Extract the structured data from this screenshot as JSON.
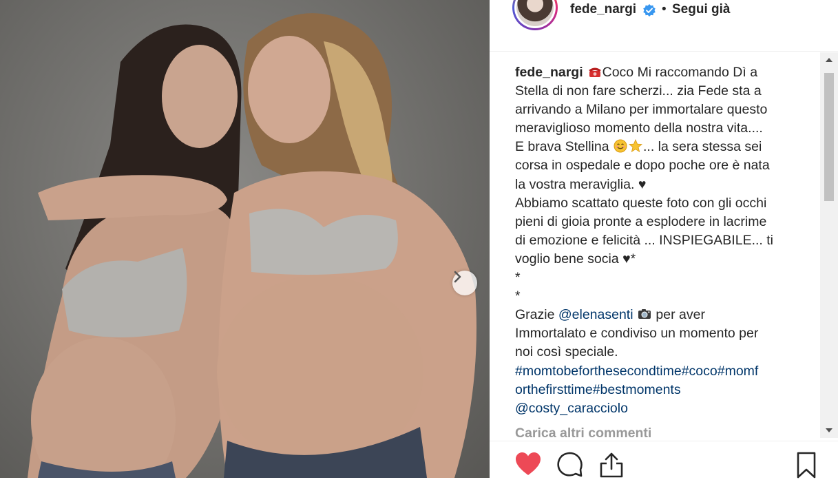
{
  "post": {
    "photo_alt_icon": "carousel-next-icon"
  },
  "header": {
    "username": "fede_nargi",
    "verified_icon": "verified-badge-icon",
    "separator": "•",
    "follow_status": "Segui già"
  },
  "caption": {
    "username": "fede_nargi",
    "lines": [
      "Coco Mi raccomando Dì a",
      "Stella di non fare scherzi... zia Fede sta a",
      "arrivando a Milano per immortalare questo",
      "meraviglioso momento della nostra vita....",
      "E brava Stellina",
      "... la sera stessa sei",
      "corsa in ospedale e dopo poche ore è nata",
      "la vostra meraviglia. ♥",
      "Abbiamo scattato queste foto con gli occhi",
      "pieni di gioia pronte a esplodere in lacrime",
      "di emozione e felicità ... INSPIEGABILE... ti",
      "voglio bene socia ♥*",
      "*",
      "*",
      "Grazie",
      "@elenasenti",
      "per aver",
      "Immortalato e condiviso un momento per",
      "noi così speciale.",
      "#momtobeforthesecondtime#coco#momf",
      "orthefirsttime#bestmoments",
      "@costy_caracciolo"
    ]
  },
  "load_more": "Carica altri commenti",
  "colors": {
    "like": "#ed4956",
    "verified": "#3897f0",
    "link": "#003569",
    "muted": "#999999"
  },
  "actions": {
    "like_icon": "heart-icon",
    "comment_icon": "comment-icon",
    "share_icon": "share-icon",
    "save_icon": "bookmark-icon"
  }
}
